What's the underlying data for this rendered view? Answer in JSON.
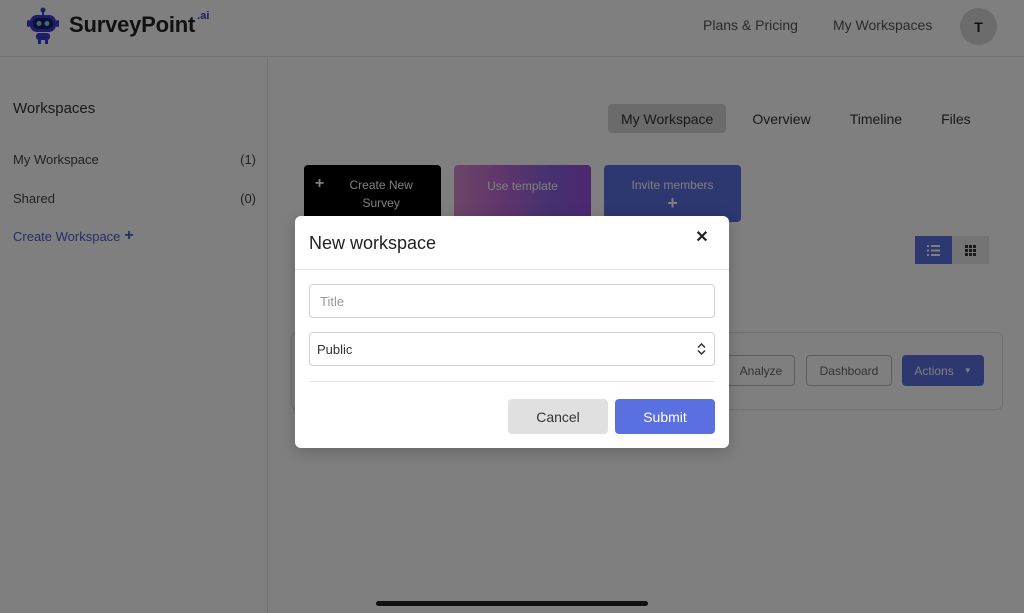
{
  "header": {
    "logo_text": "SurveyPoint",
    "logo_suffix": ".ai",
    "nav": [
      "Plans & Pricing",
      "My Workspaces"
    ],
    "avatar_initial": "T"
  },
  "sidebar": {
    "title": "Workspaces",
    "items": [
      {
        "label": "My Workspace",
        "count": "(1)"
      },
      {
        "label": "Shared",
        "count": "(0)"
      }
    ],
    "create_label": "Create Workspace",
    "create_icon": "plus-icon"
  },
  "main": {
    "tabs": [
      "My Workspace",
      "Overview",
      "Timeline",
      "Files"
    ],
    "active_tab": "My Workspace",
    "cards": {
      "create": "Create New Survey",
      "template": "Use template",
      "invite": "Invite members"
    },
    "row_buttons": {
      "analyze": "Analyze",
      "dashboard": "Dashboard",
      "actions": "Actions"
    }
  },
  "modal": {
    "title": "New workspace",
    "title_placeholder": "Title",
    "visibility_value": "Public",
    "cancel_label": "Cancel",
    "submit_label": "Submit"
  },
  "colors": {
    "accent": "#5a6fe0",
    "overlay": "rgba(0,0,0,0.5)"
  }
}
